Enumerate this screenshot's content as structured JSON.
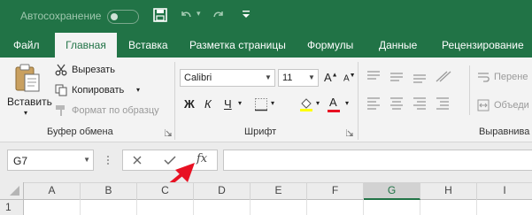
{
  "titlebar": {
    "autosave_label": "Автосохранение"
  },
  "tabs": [
    "Файл",
    "Главная",
    "Вставка",
    "Разметка страницы",
    "Формулы",
    "Данные",
    "Рецензирование"
  ],
  "clipboard": {
    "paste_label": "Вставить",
    "cut_label": "Вырезать",
    "copy_label": "Копировать",
    "format_painter_label": "Формат по образцу",
    "group_label": "Буфер обмена"
  },
  "font": {
    "name": "Calibri",
    "size": "11",
    "bold": "Ж",
    "italic": "К",
    "underline": "Ч",
    "group_label": "Шрифт",
    "font_color": "#e81123"
  },
  "alignment": {
    "wrap_label": "Перене",
    "merge_label": "Объеди",
    "group_label": "Выравнива"
  },
  "formula_bar": {
    "cell_ref": "G7",
    "fx": "fx",
    "content": ""
  },
  "grid": {
    "columns": [
      "A",
      "B",
      "C",
      "D",
      "E",
      "F",
      "G",
      "H",
      "I"
    ],
    "selected_column": "G",
    "rows": [
      "1"
    ]
  },
  "colors": {
    "excel_green": "#217346",
    "arrow_red": "#e81123"
  }
}
